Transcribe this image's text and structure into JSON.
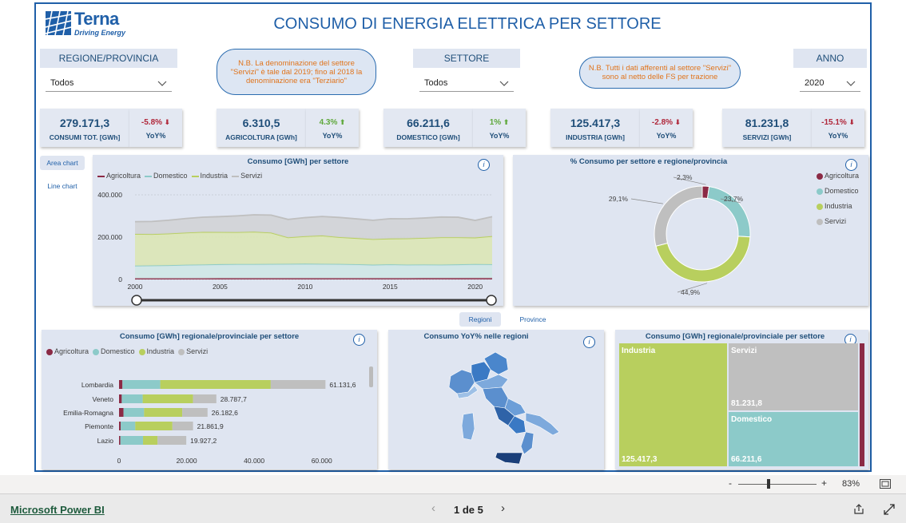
{
  "report": {
    "title": "CONSUMO DI ENERGIA ELETTRICA PER SETTORE",
    "logo": {
      "name": "Terna",
      "tagline": "Driving Energy"
    }
  },
  "slicers": {
    "region": {
      "label": "REGIONE/PROVINCIA",
      "value": "Todos"
    },
    "sector": {
      "label": "SETTORE",
      "value": "Todos"
    },
    "year": {
      "label": "ANNO",
      "value": "2020"
    }
  },
  "notes": {
    "servizi_name": "N.B. La denominazione del settore \"Servizi\" è tale dal 2019; fino al 2018 la denominazione era \"Terziario\"",
    "servizi_fs": "N.B. Tutti i dati afferenti al settore \"Servizi\" sono al netto delle FS per trazione"
  },
  "kpis": [
    {
      "value": "279.171,3",
      "label": "CONSUMI TOT. [GWh]",
      "yoy": "-5.8%",
      "direction": "down",
      "yoy_label": "YoY%"
    },
    {
      "value": "6.310,5",
      "label": "AGRICOLTURA [GWh]",
      "yoy": "4.3%",
      "direction": "up",
      "yoy_label": "YoY%"
    },
    {
      "value": "66.211,6",
      "label": "DOMESTICO [GWh]",
      "yoy": "1%",
      "direction": "up",
      "yoy_label": "YoY%"
    },
    {
      "value": "125.417,3",
      "label": "INDUSTRIA [GWh]",
      "yoy": "-2.8%",
      "direction": "down",
      "yoy_label": "YoY%"
    },
    {
      "value": "81.231,8",
      "label": "SERVIZI [GWh]",
      "yoy": "-15.1%",
      "direction": "down",
      "yoy_label": "YoY%"
    }
  ],
  "colors": {
    "agricoltura": "#8b2a45",
    "domestico": "#8ccac9",
    "industria": "#b8cf5e",
    "servizi": "#bfbfbf",
    "up": "#5fa83c",
    "down": "#b0273a",
    "accent": "#1f5fa8"
  },
  "toggles": {
    "area": "Area chart",
    "line": "Line chart"
  },
  "geo_toggles": {
    "regioni": "Regioni",
    "province": "Province"
  },
  "legend": [
    "Agricoltura",
    "Domestico",
    "Industria",
    "Servizi"
  ],
  "panels": {
    "area_title": "Consumo [GWh] per settore",
    "donut_title": "% Consumo per settore e regione/provincia",
    "bar_title": "Consumo [GWh] regionale/provinciale per settore",
    "map_title": "Consumo YoY% nelle regioni",
    "treemap_title": "Consumo [GWh] regionale/provinciale per settore"
  },
  "chart_data": [
    {
      "type": "area",
      "title": "Consumo [GWh] per settore",
      "stacked": true,
      "x": [
        2000,
        2001,
        2002,
        2003,
        2004,
        2005,
        2006,
        2007,
        2008,
        2009,
        2010,
        2011,
        2012,
        2013,
        2014,
        2015,
        2016,
        2017,
        2018,
        2019,
        2020,
        2021
      ],
      "x_ticks": [
        "2000",
        "2005",
        "2010",
        "2015",
        "2020"
      ],
      "y_ticks": [
        "0",
        "200.000",
        "400.000"
      ],
      "ylim": [
        0,
        400000
      ],
      "series": [
        {
          "name": "Agricoltura",
          "values": [
            5000,
            5100,
            5200,
            5300,
            5400,
            5500,
            5600,
            5700,
            5800,
            5800,
            5800,
            5700,
            5700,
            5600,
            5600,
            5700,
            5800,
            5900,
            6000,
            6050,
            6310,
            6300
          ]
        },
        {
          "name": "Domestico",
          "values": [
            60000,
            61000,
            62000,
            64000,
            65000,
            66500,
            67000,
            67000,
            67500,
            68000,
            68500,
            68000,
            67500,
            66000,
            64000,
            65500,
            64000,
            64500,
            64000,
            65000,
            66212,
            65500
          ]
        },
        {
          "name": "Industria",
          "values": [
            150000,
            148000,
            150000,
            152000,
            154000,
            152000,
            151000,
            153000,
            148000,
            125000,
            130000,
            134000,
            127000,
            124000,
            121000,
            122000,
            124000,
            126000,
            129000,
            128000,
            125417,
            133000
          ]
        },
        {
          "name": "Servizi",
          "values": [
            58000,
            60000,
            63000,
            67000,
            70000,
            73000,
            77000,
            80000,
            83000,
            85000,
            88000,
            90000,
            93000,
            91000,
            89000,
            94000,
            93000,
            94000,
            96000,
            95000,
            81232,
            92000
          ]
        }
      ]
    },
    {
      "type": "pie",
      "title": "% Consumo per settore e regione/provincia",
      "labels": [
        "Agricoltura",
        "Domestico",
        "Industria",
        "Servizi"
      ],
      "values": [
        2.3,
        23.7,
        44.9,
        29.1
      ],
      "value_labels": [
        "2,3%",
        "23,7%",
        "44,9%",
        "29,1%"
      ]
    },
    {
      "type": "bar",
      "title": "Consumo [GWh] regionale/provinciale per settore",
      "orientation": "horizontal",
      "stacked": true,
      "categories": [
        "Lombardia",
        "Veneto",
        "Emilia-Romagna",
        "Piemonte",
        "Lazio"
      ],
      "totals_labels": [
        "61.131,6",
        "28.787,7",
        "26.182,6",
        "21.861,9",
        "19.927,2"
      ],
      "x_ticks": [
        "0",
        "20.000",
        "40.000",
        "60.000"
      ],
      "xlim": [
        0,
        70000
      ],
      "series": [
        {
          "name": "Agricoltura",
          "values": [
            1000,
            800,
            1300,
            500,
            400
          ]
        },
        {
          "name": "Domestico",
          "values": [
            11200,
            6200,
            6100,
            4300,
            6700
          ]
        },
        {
          "name": "Industria",
          "values": [
            32700,
            14900,
            11300,
            11000,
            4300
          ]
        },
        {
          "name": "Servizi",
          "values": [
            16200,
            6900,
            7500,
            6100,
            8500
          ]
        }
      ]
    },
    {
      "type": "treemap",
      "title": "Consumo [GWh] regionale/provinciale per settore",
      "labels": [
        "Industria",
        "Servizi",
        "Domestico",
        "Agricoltura"
      ],
      "values": [
        125417.3,
        81231.8,
        66211.6,
        6310.5
      ],
      "value_labels": [
        "125.417,3",
        "81.231,8",
        "66.211,6",
        ""
      ]
    }
  ],
  "footer": {
    "brand": "Microsoft Power BI",
    "page": "1 de 5",
    "zoom": "83%"
  }
}
